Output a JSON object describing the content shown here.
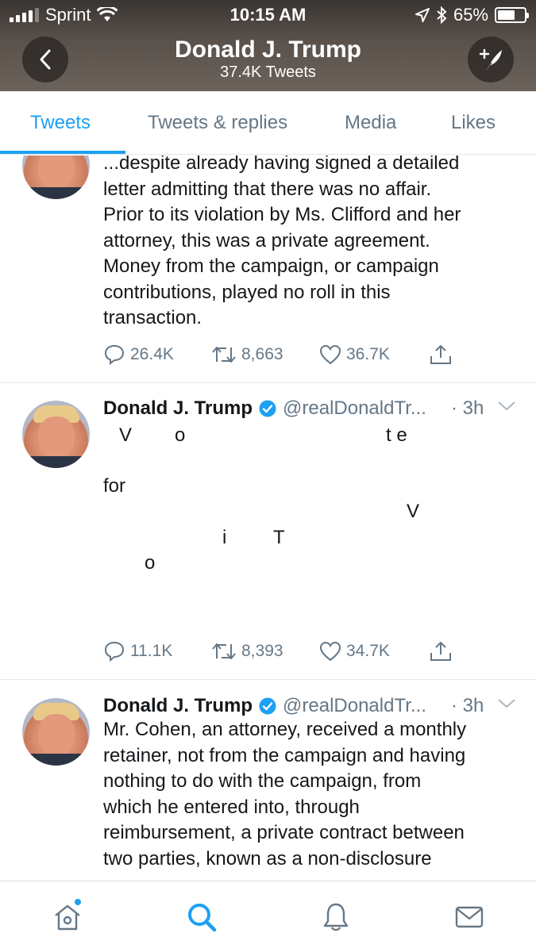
{
  "status_bar": {
    "carrier": "Sprint",
    "time": "10:15 AM",
    "battery_percent": "65%",
    "battery_level": 0.65
  },
  "header": {
    "name": "Donald J. Trump",
    "tweet_count": "37.4K Tweets",
    "icons": {
      "back": "chevron-left-icon",
      "compose": "compose-feather-icon"
    }
  },
  "tabs": [
    {
      "label": "Tweets",
      "active": true
    },
    {
      "label": "Tweets & replies",
      "active": false
    },
    {
      "label": "Media",
      "active": false
    },
    {
      "label": "Likes",
      "active": false
    }
  ],
  "tweets": [
    {
      "text_lines": [
        "...despite already having signed a detailed",
        "letter admitting that there was no affair.",
        "Prior to its violation by Ms. Clifford and her",
        "attorney, this was a private agreement.",
        "Money from the campaign, or campaign",
        "contributions, played no roll in this",
        "transaction."
      ],
      "replies": "26.4K",
      "retweets": "8,663",
      "likes": "36.7K"
    },
    {
      "name": "Donald J. Trump",
      "handle": "@realDonaldTr...",
      "time": "· 3h",
      "fragments": [
        "V",
        "o",
        "t e",
        "for",
        "V",
        "i",
        "T",
        "o"
      ],
      "replies": "11.1K",
      "retweets": "8,393",
      "likes": "34.7K"
    },
    {
      "name": "Donald J. Trump",
      "handle": "@realDonaldTr...",
      "time": "· 3h",
      "text_lines": [
        "Mr. Cohen, an attorney, received a monthly",
        "retainer, not from the campaign and having",
        "nothing to do with the campaign, from",
        "which he entered into, through",
        "reimbursement, a private contract between",
        "two parties, known as a non-disclosure"
      ]
    }
  ],
  "colors": {
    "accent": "#1da1f2",
    "secondary_text": "#657786",
    "divider": "#e1e8ed"
  },
  "bottom_nav": [
    {
      "icon": "home-icon",
      "active": false,
      "has_notification_dot": true
    },
    {
      "icon": "search-icon",
      "active": true
    },
    {
      "icon": "bell-icon",
      "active": false
    },
    {
      "icon": "mail-icon",
      "active": false
    }
  ]
}
